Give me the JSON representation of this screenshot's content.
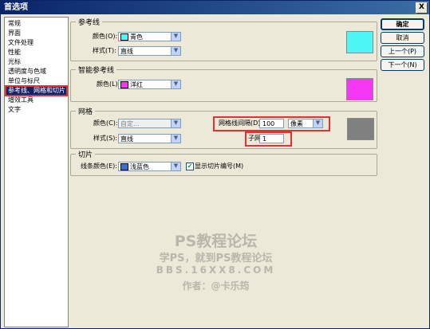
{
  "window": {
    "title": "首选项",
    "close_label": "X"
  },
  "sidebar": {
    "items": [
      {
        "label": "常规"
      },
      {
        "label": "界面"
      },
      {
        "label": "文件处理"
      },
      {
        "label": "性能"
      },
      {
        "label": "光标"
      },
      {
        "label": "透明度与色域"
      },
      {
        "label": "单位与标尺"
      },
      {
        "label": "参考线、网格和切片"
      },
      {
        "label": "增效工具"
      },
      {
        "label": "文字"
      }
    ],
    "selected": "参考线、网格和切片"
  },
  "guides": {
    "group_title": "参考线",
    "color_label": "颜色(O):",
    "color_value": "青色",
    "color_hex": "#4ff6f6",
    "style_label": "样式(T):",
    "style_value": "直线"
  },
  "smart_guides": {
    "group_title": "智能参考线",
    "color_label": "颜色(L):",
    "color_value": "洋红",
    "color_hex": "#f437f4"
  },
  "grid": {
    "group_title": "网格",
    "color_label": "颜色(C):",
    "color_value": "自定...",
    "style_label": "样式(S):",
    "style_value": "直线",
    "gridline_label": "网格线间隔(D):",
    "gridline_value": "100",
    "unit_value": "像素",
    "subdiv_label": "子网格(V):",
    "subdiv_value": "1",
    "color_hex": "#808080"
  },
  "slices": {
    "group_title": "切片",
    "line_color_label": "线条颜色(E):",
    "line_color_value": "浅蓝色",
    "line_color_hex": "#3b6fd6",
    "show_numbers_label": "显示切片编号(M)",
    "show_numbers_checked": true
  },
  "buttons": {
    "ok": "确定",
    "cancel": "取消",
    "prev": "上一个(P)",
    "next": "下一个(N)"
  },
  "watermark": {
    "line1": "PS教程论坛",
    "line2": "学PS，就到PS教程论坛",
    "line3": "BBS.16XX8.COM",
    "line4": "作者：@卡乐筠"
  },
  "colors": {
    "highlight_red": "#e8302f",
    "title_blue": "#0a246a"
  }
}
